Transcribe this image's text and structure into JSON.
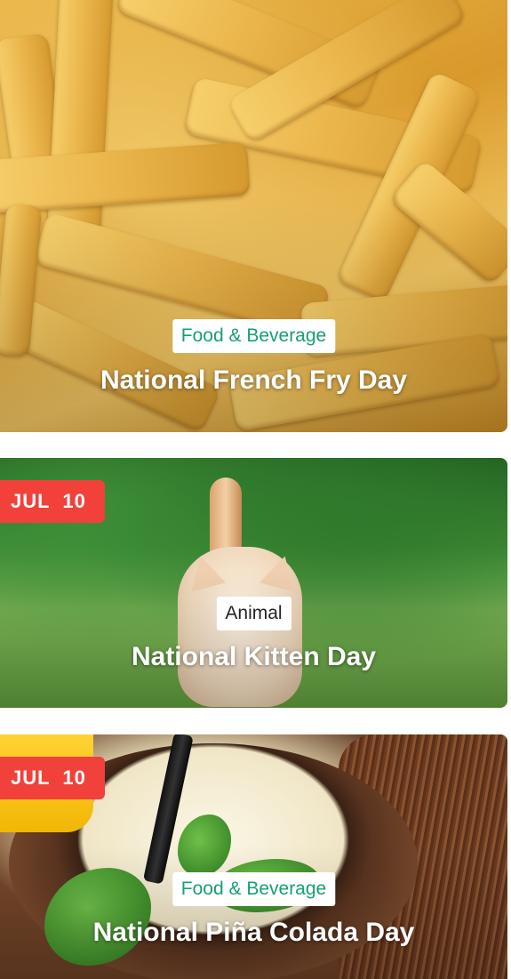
{
  "cards": [
    {
      "category": "Food & Beverage",
      "title": "National French Fry Day",
      "date": "",
      "image": "french-fries-photo"
    },
    {
      "category": "Animal",
      "title": "National Kitten Day",
      "date": "JUL  10",
      "image": "kitten-in-grass-photo"
    },
    {
      "category": "Food & Beverage",
      "title": "National Piña Colada Day",
      "date": "JUL  10",
      "image": "pina-colada-in-coconut-photo"
    }
  ],
  "colors": {
    "date_badge": "#f1413a",
    "category_food": "#16a06f",
    "category_animal": "#222222"
  }
}
